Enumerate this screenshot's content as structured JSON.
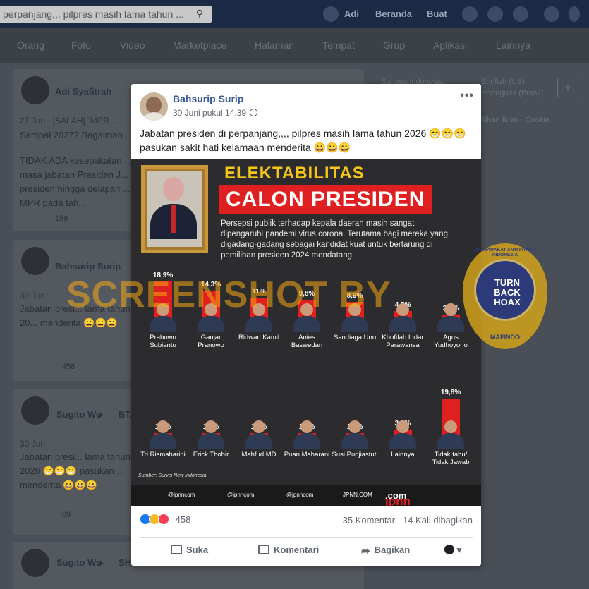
{
  "topbar": {
    "search_text": "perpanjang,,, pilpres masih lama tahun ...",
    "user": "Adi",
    "home": "Beranda",
    "create": "Buat"
  },
  "nav": {
    "items": [
      "Orang",
      "Foto",
      "Video",
      "Marketplace",
      "Halaman",
      "Tempat",
      "Grup",
      "Aplikasi",
      "Lainnya"
    ]
  },
  "feed": [
    {
      "name": "Adi Syafitrah",
      "meta": "27 Jun · [SALAH] \"MPR ...",
      "text": "Sampai 2027? Bagaiman ...",
      "text2": "TIDAK ADA kesepakatan ... masa jabatan Presiden J... presiden hingga delapan ... MPR pada tah...",
      "count": "156"
    },
    {
      "name": "Bahsurip Surip",
      "meta": "30 Jun",
      "text": "Jabatan presi... lama tahun 20... menderita 😀😀😀",
      "count": "458"
    },
    {
      "name": "Sugito Wu",
      "arrow": "▸",
      "group": "BT...",
      "meta": "30 Jun",
      "text": "Jabatan presi... lama tahun 2026 😁😁😁 pasukan ... menderita 😀😀😀",
      "count": "89"
    },
    {
      "name": "Sugito Wu",
      "arrow": "▸",
      "group": "SH..."
    }
  ],
  "rightcol": {
    "lang1": "Bahasa Indonesia",
    "lang2": "English (US)",
    "lang3": "Português (Brasil)",
    "links": "Privasi · Ketentuan · Iklan · Pilihan Iklan · Cookie"
  },
  "post": {
    "author": "Bahsurip Surip",
    "time": "30 Juni pukul 14.39",
    "text": "Jabatan presiden di perpanjang,,,, pilpres masih lama tahun 2026 😁😁😁 pasukan sakit hati kelamaan menderita 😀😀😀",
    "reactions": "458",
    "comments": "35 Komentar",
    "shares": "14 Kali dibagikan",
    "actions": {
      "like": "Suka",
      "comment": "Komentari",
      "share": "Bagikan"
    }
  },
  "poster": {
    "title1": "ELEKTABILITAS",
    "title2": "CALON PRESIDEN",
    "desc": "Persepsi publik terhadap kepala daerah masih sangat dipengaruhi pandemi virus corona. Terutama bagi mereka yang digadang-gadang sebagai kandidat kuat untuk bertarung di pemilihan presiden 2024 mendatang.",
    "row1": [
      {
        "name": "Prabowo Subianto",
        "pct": "18,9%"
      },
      {
        "name": "Ganjar Pranowo",
        "pct": "14,3%"
      },
      {
        "name": "Ridwan Kamil",
        "pct": "11%"
      },
      {
        "name": "Anies Baswedan",
        "pct": "9,8%"
      },
      {
        "name": "Sandiaga Uno",
        "pct": "8,9%"
      },
      {
        "name": "Khofifah Indar Parawansa",
        "pct": "4,5%"
      },
      {
        "name": "Agus Yudhoyono",
        "pct": "2,7%"
      }
    ],
    "row2": [
      {
        "name": "Tri Rismaharini",
        "pct": "1,6%"
      },
      {
        "name": "Erick Thohir",
        "pct": "1,3%"
      },
      {
        "name": "Mahfud MD",
        "pct": "1,2%"
      },
      {
        "name": "Puan Maharani",
        "pct": "1,1%"
      },
      {
        "name": "Susi Pudjiastuti",
        "pct": "1,0%"
      },
      {
        "name": "Lainnya",
        "pct": "3,9%"
      },
      {
        "name": "Tidak tahu/ Tidak Jawab",
        "pct": "19,8%"
      }
    ],
    "source": "Sumber: Survei New Indonesia",
    "social": [
      "@jpnncom",
      "@jpnncom",
      "@jpnncom",
      "JPNN.COM"
    ],
    "brand_red": "jpnn",
    "brand_white": ".com"
  },
  "watermark": "SCREENSHOT BY",
  "seal": {
    "arc_top": "MASYARAKAT ANTI FITNAH INDONESIA",
    "l1": "TURN",
    "l2": "BACK",
    "l3": "HOAX",
    "arc_bottom": "MAFINDO"
  },
  "colors": {
    "fb_blue": "#385898",
    "accent_red": "#e02020",
    "title_yellow": "#f5c518"
  }
}
